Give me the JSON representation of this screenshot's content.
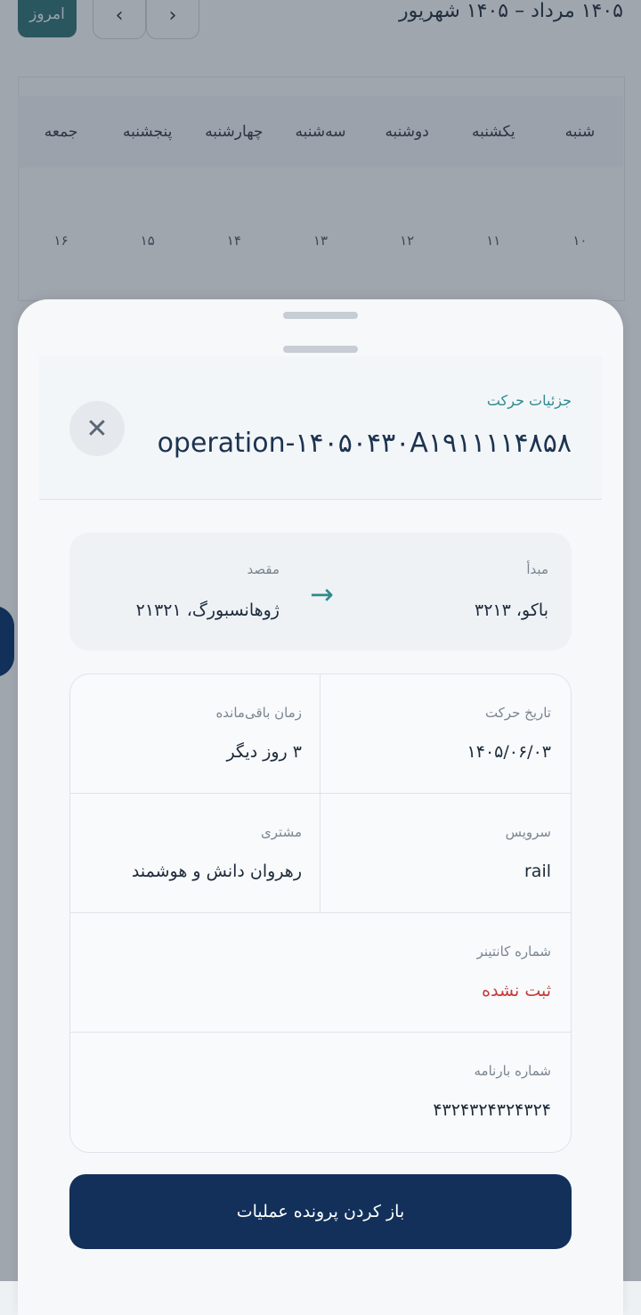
{
  "calendar": {
    "today_label": "امروز",
    "prev_icon": "chevron-left",
    "next_icon": "chevron-right",
    "range_title": "۱۴۰۵ مرداد – ۱۴۰۵ شهریور",
    "weekdays": [
      "شنبه",
      "یکشنبه",
      "دوشنبه",
      "سه‌شنبه",
      "چهارشنبه",
      "پنجشنبه",
      "جمعه"
    ],
    "days": [
      "۱۰",
      "۱۱",
      "۱۲",
      "۱۳",
      "۱۴",
      "۱۵",
      "۱۶"
    ]
  },
  "sheet": {
    "eyebrow": "جزئیات حرکت",
    "title": "operation-۱۴۰۵۰۴۳۰A۱۹۱۱۱۱۴۸۵۸",
    "close_icon": "close-icon",
    "route": {
      "origin_label": "مبدأ",
      "origin_value": "باکو، ۳۲۱۳",
      "dest_label": "مقصد",
      "dest_value": "ژوهانسبورگ، ۲۱۳۲۱",
      "arrow_icon": "arrow-right-icon"
    },
    "details": {
      "departure_date_label": "تاریخ حرکت",
      "departure_date_value": "۱۴۰۵/۰۶/۰۳",
      "remaining_label": "زمان باقی‌مانده",
      "remaining_value": "۳ روز دیگر",
      "service_label": "سرویس",
      "service_value": "rail",
      "customer_label": "مشتری",
      "customer_value": "رهروان دانش و هوشمند",
      "container_label": "شماره کانتینر",
      "container_value": "ثبت نشده",
      "bill_label": "شماره بارنامه",
      "bill_value": "۴۳۲۴۳۲۴۳۲۴۳۲۴"
    },
    "cta_label": "باز کردن پرونده عملیات"
  },
  "colors": {
    "accent": "#2e8a8f",
    "primary": "#12305a",
    "warning": "#c43b3b"
  }
}
